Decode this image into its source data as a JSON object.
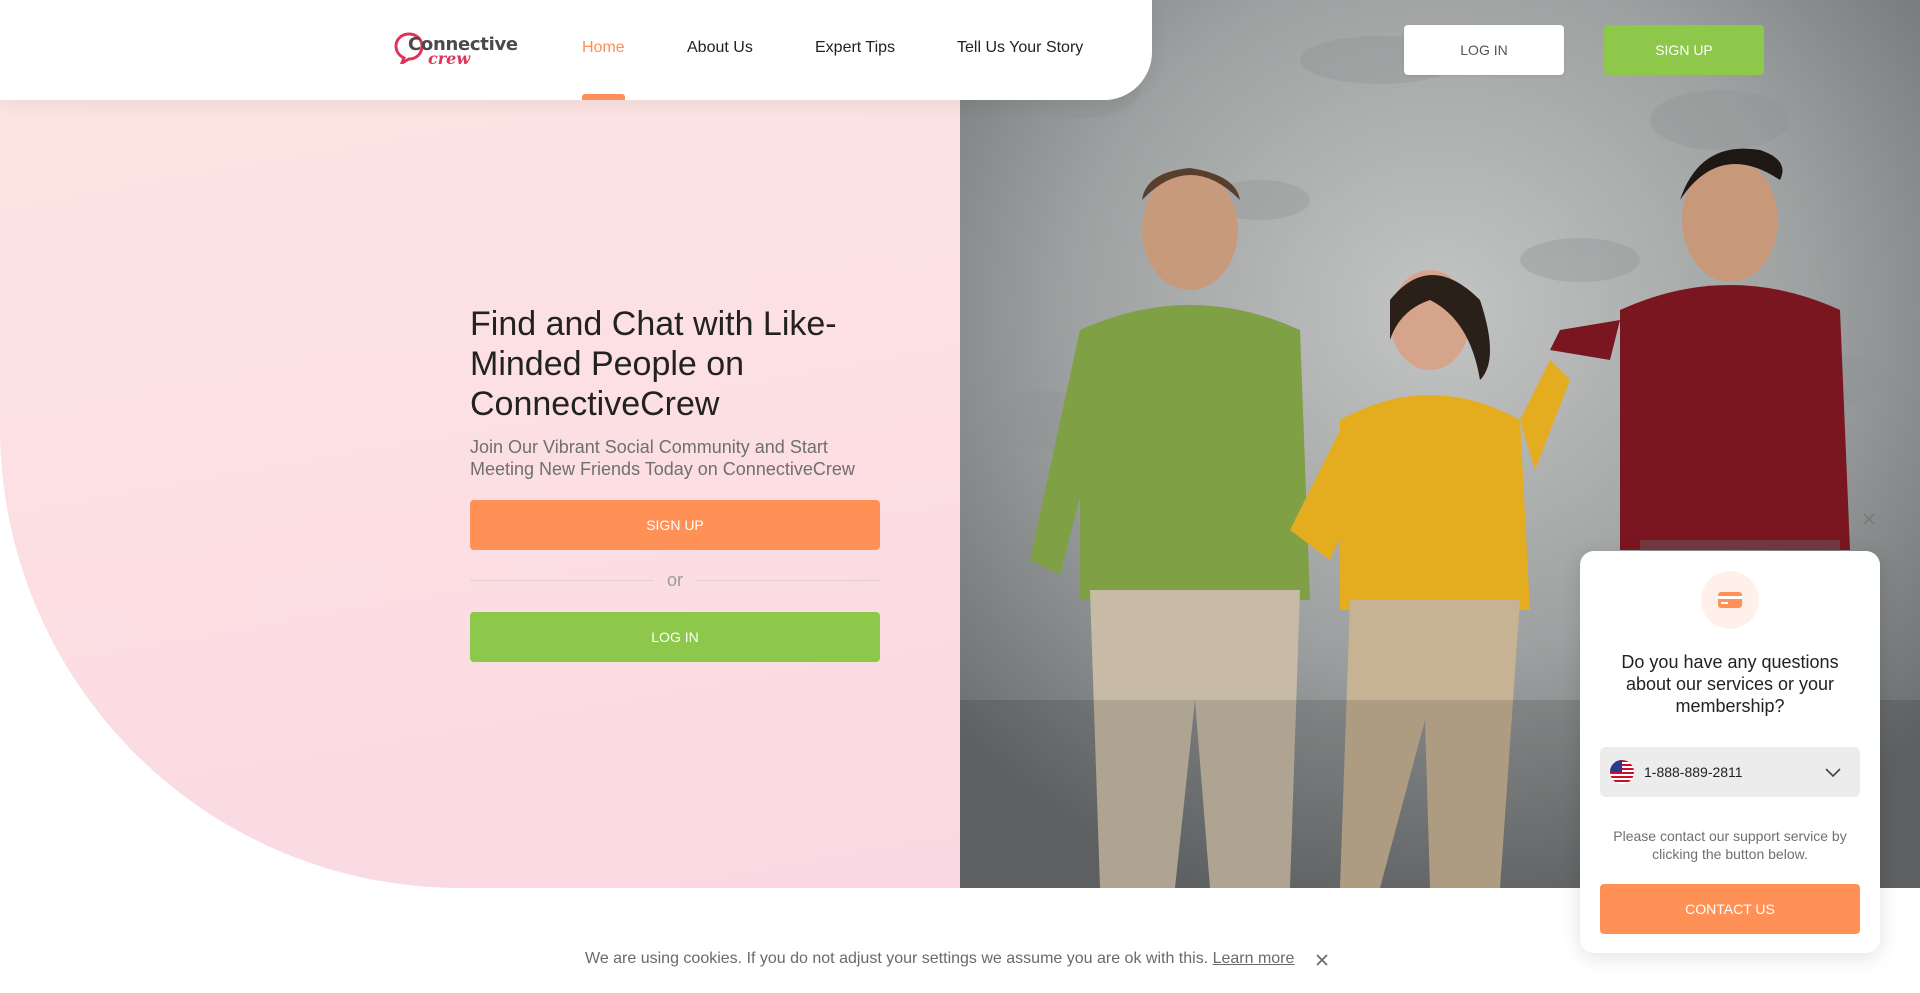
{
  "brand": {
    "name_part1": "Connective",
    "name_part2": "crew",
    "colors": {
      "accent": "#ff9157",
      "green": "#8dc84a",
      "logo_red": "#e2325a"
    }
  },
  "nav": {
    "links": [
      {
        "label": "Home",
        "active": true
      },
      {
        "label": "About Us",
        "active": false
      },
      {
        "label": "Expert Tips",
        "active": false
      },
      {
        "label": "Tell Us Your Story",
        "active": false
      }
    ],
    "login_label": "LOG IN",
    "signup_label": "SIGN UP"
  },
  "hero": {
    "title": "Find and Chat with Like-Minded People on ConnectiveCrew",
    "subtitle": "Join Our Vibrant Social Community and Start Meeting New Friends Today on ConnectiveCrew",
    "signup_label": "SIGN UP",
    "or_label": "or",
    "login_label": "LOG IN",
    "photo_icon": "three-people-photo"
  },
  "support_widget": {
    "icon": "credit-card-icon",
    "question": "Do you have any questions about our services or your membership?",
    "phone": {
      "country_icon": "us-flag-icon",
      "number": "1-888-889-2811"
    },
    "note": "Please contact our support service by clicking the button below.",
    "button_label": "CONTACT US"
  },
  "cookie": {
    "text": "We are using cookies. If you do not adjust your settings we assume you are ok with this.",
    "link_label": "Learn more"
  }
}
